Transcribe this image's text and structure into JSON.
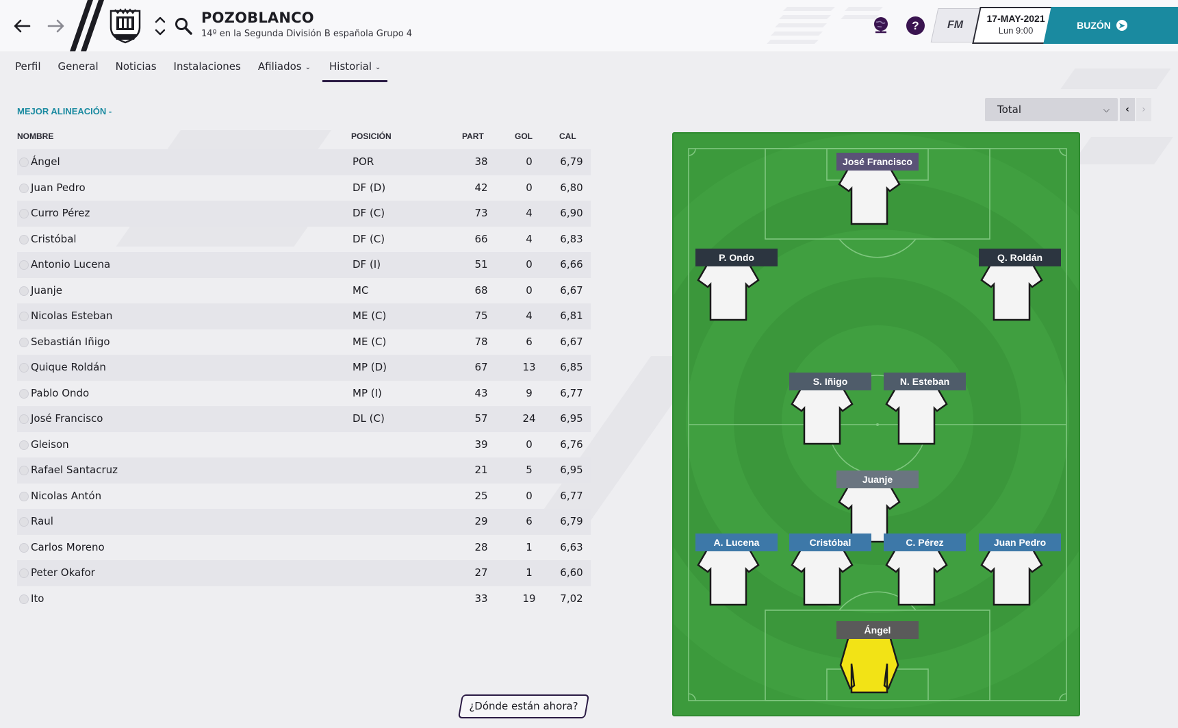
{
  "header": {
    "club_name": "POZOBLANCO",
    "club_subtitle": "14º en la Segunda División B española Grupo 4",
    "date": "17-MAY-2021",
    "time": "Lun 9:00",
    "fm_label": "FM",
    "help_label": "?",
    "inbox_label": "BUZÓN"
  },
  "tabs": [
    {
      "label": "Perfil"
    },
    {
      "label": "General"
    },
    {
      "label": "Noticias"
    },
    {
      "label": "Instalaciones"
    },
    {
      "label": "Afiliados",
      "has_dropdown": true
    },
    {
      "label": "Historial",
      "has_dropdown": true,
      "active": true
    }
  ],
  "section": {
    "title": "MEJOR ALINEACIÓN -",
    "columns": {
      "name": "NOMBRE",
      "position": "POSICIÓN",
      "apps": "PART",
      "goals": "GOL",
      "rating": "CAL"
    },
    "filter_value": "Total"
  },
  "players": [
    {
      "name": "Ángel",
      "position": "POR",
      "apps": "38",
      "goals": "0",
      "rating": "6,79"
    },
    {
      "name": "Juan Pedro",
      "position": "DF (D)",
      "apps": "42",
      "goals": "0",
      "rating": "6,80"
    },
    {
      "name": "Curro Pérez",
      "position": "DF (C)",
      "apps": "73",
      "goals": "4",
      "rating": "6,90"
    },
    {
      "name": "Cristóbal",
      "position": "DF (C)",
      "apps": "66",
      "goals": "4",
      "rating": "6,83"
    },
    {
      "name": "Antonio Lucena",
      "position": "DF (I)",
      "apps": "51",
      "goals": "0",
      "rating": "6,66"
    },
    {
      "name": "Juanje",
      "position": "MC",
      "apps": "68",
      "goals": "0",
      "rating": "6,67"
    },
    {
      "name": "Nicolas Esteban",
      "position": "ME (C)",
      "apps": "75",
      "goals": "4",
      "rating": "6,81"
    },
    {
      "name": "Sebastián Iñigo",
      "position": "ME (C)",
      "apps": "78",
      "goals": "6",
      "rating": "6,67"
    },
    {
      "name": "Quique Roldán",
      "position": "MP (D)",
      "apps": "67",
      "goals": "13",
      "rating": "6,85"
    },
    {
      "name": "Pablo Ondo",
      "position": "MP (I)",
      "apps": "43",
      "goals": "9",
      "rating": "6,77"
    },
    {
      "name": "José Francisco",
      "position": "DL (C)",
      "apps": "57",
      "goals": "24",
      "rating": "6,95"
    },
    {
      "name": "Gleison",
      "position": "",
      "apps": "39",
      "goals": "0",
      "rating": "6,76"
    },
    {
      "name": "Rafael Santacruz",
      "position": "",
      "apps": "21",
      "goals": "5",
      "rating": "6,95"
    },
    {
      "name": "Nicolas Antón",
      "position": "",
      "apps": "25",
      "goals": "0",
      "rating": "6,77"
    },
    {
      "name": "Raul",
      "position": "",
      "apps": "29",
      "goals": "6",
      "rating": "6,79"
    },
    {
      "name": "Carlos Moreno",
      "position": "",
      "apps": "28",
      "goals": "1",
      "rating": "6,63"
    },
    {
      "name": "Peter Okafor",
      "position": "",
      "apps": "27",
      "goals": "1",
      "rating": "6,60"
    },
    {
      "name": "Ito",
      "position": "",
      "apps": "33",
      "goals": "19",
      "rating": "7,02"
    }
  ],
  "formation": {
    "players": [
      {
        "label": "José Francisco",
        "line": "attack",
        "label_color": "#5a5277"
      },
      {
        "label": "P. Ondo",
        "line": "amc_left",
        "label_color": "#2c3540"
      },
      {
        "label": "Q. Roldán",
        "line": "amc_right",
        "label_color": "#2c3540"
      },
      {
        "label": "S. Iñigo",
        "line": "mid_left",
        "label_color": "#4f5c6a"
      },
      {
        "label": "N. Esteban",
        "line": "mid_right",
        "label_color": "#4f5c6a"
      },
      {
        "label": "Juanje",
        "line": "dm",
        "label_color": "#6a7580"
      },
      {
        "label": "A. Lucena",
        "line": "def_left",
        "label_color": "#3d78a8"
      },
      {
        "label": "Cristóbal",
        "line": "def_cl",
        "label_color": "#3d78a8"
      },
      {
        "label": "C. Pérez",
        "line": "def_cr",
        "label_color": "#3d78a8"
      },
      {
        "label": "Juan Pedro",
        "line": "def_right",
        "label_color": "#3d78a8"
      },
      {
        "label": "Ángel",
        "line": "gk",
        "label_color": "#5a5a5a",
        "goalkeeper": true
      }
    ]
  },
  "footer_button": "¿Dónde están ahora?",
  "colors": {
    "accent": "#1a8aa0",
    "dark": "#2a1a44",
    "pitch": "#3c9a3c"
  }
}
